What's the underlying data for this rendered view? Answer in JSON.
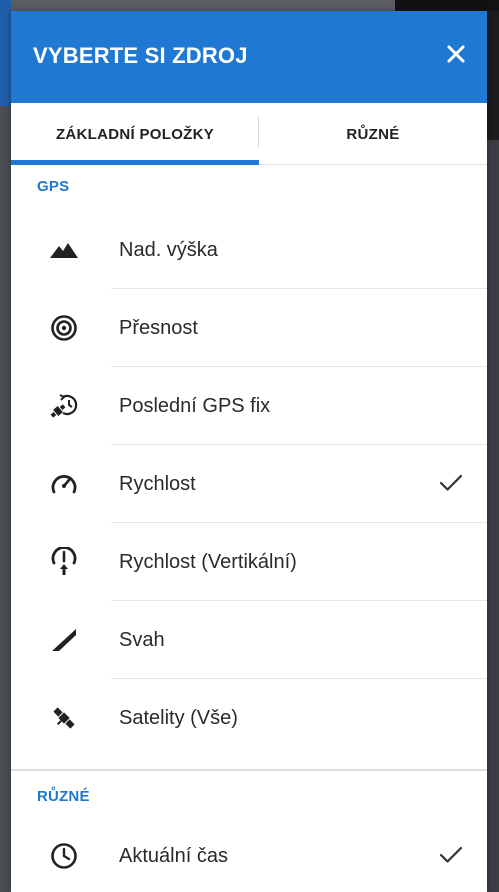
{
  "dialog": {
    "title": "VYBERTE SI ZDROJ",
    "close_icon": "close-icon"
  },
  "tabs": [
    {
      "label": "ZÁKLADNÍ POLOŽKY",
      "active": true
    },
    {
      "label": "RŮZNÉ",
      "active": false
    }
  ],
  "sections": {
    "gps": {
      "title": "GPS",
      "items": [
        {
          "label": "Nad. výška",
          "icon": "mountain-icon",
          "checked": false
        },
        {
          "label": "Přesnost",
          "icon": "target-icon",
          "checked": false
        },
        {
          "label": "Poslední GPS fix",
          "icon": "satellite-clock-icon",
          "checked": false
        },
        {
          "label": "Rychlost",
          "icon": "speedometer-icon",
          "checked": true
        },
        {
          "label": "Rychlost (Vertikální)",
          "icon": "vertical-speed-icon",
          "checked": false
        },
        {
          "label": "Svah",
          "icon": "slope-icon",
          "checked": false
        },
        {
          "label": "Satelity (Vše)",
          "icon": "satellite-icon",
          "checked": false
        }
      ]
    },
    "ruzne": {
      "title": "RŮZNÉ",
      "items": [
        {
          "label": "Aktuální čas",
          "icon": "clock-icon",
          "checked": true
        }
      ]
    }
  },
  "colors": {
    "accent": "#1f78d1",
    "text": "#2a2a2a"
  }
}
